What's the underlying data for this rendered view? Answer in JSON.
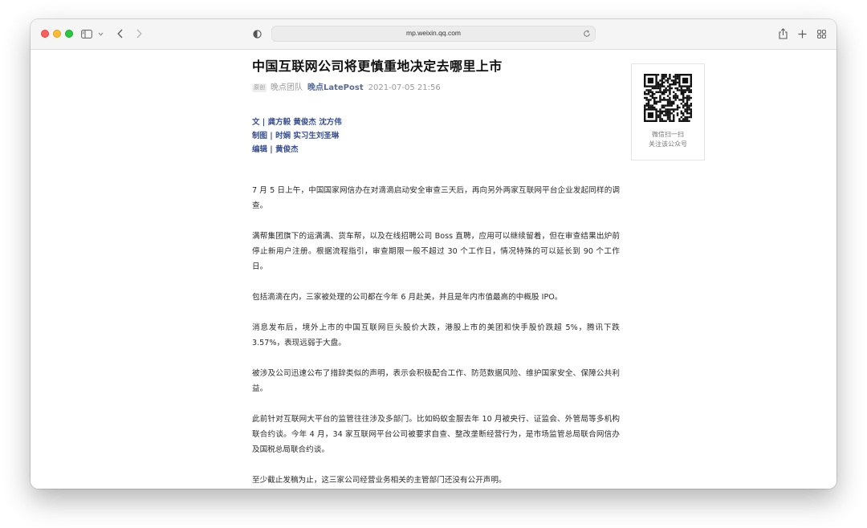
{
  "browser": {
    "url": "mp.weixin.qq.com",
    "icons": {
      "sidebar": "sidebar-icon",
      "chevron": "chevron-down-icon",
      "back": "back-arrow-icon",
      "forward": "forward-arrow-icon",
      "privacy": "privacy-shield-icon",
      "reload": "reload-icon",
      "share": "share-icon",
      "new_tab": "plus-icon",
      "tab_overview": "tab-overview-icon"
    }
  },
  "article": {
    "title": "中国互联网公司将更慎重地决定去哪里上市",
    "original_tag": "原创",
    "author": "晚点团队",
    "account": "晚点LatePost",
    "date": "2021-07-05 21:56",
    "credits": [
      "文 | 龚方毅 黄俊杰 沈方伟",
      "制图 | 时娴 实习生刘圣琳",
      "编辑 | 黄俊杰"
    ],
    "paragraphs": [
      "7 月 5 日上午，中国国家网信办在对滴滴启动安全审查三天后，再向另外两家互联网平台企业发起同样的调查。",
      "满帮集团旗下的运满满、货车帮，以及在线招聘公司 Boss 直聘，应用可以继续留着，但在审查结果出炉前停止新用户注册。根据流程指引，审查期限一般不超过 30 个工作日，情况特殊的可以延长到 90 个工作日。",
      "包括滴滴在内，三家被处理的公司都在今年 6 月赴美，并且是年内市值最高的中概股 IPO。",
      "消息发布后，境外上市的中国互联网巨头股价大跌，港股上市的美团和快手股价跌超 5%，腾讯下跌 3.57%，表现远弱于大盘。",
      "被涉及公司迅速公布了措辞类似的声明，表示会积极配合工作、防范数据风险、维护国家安全、保障公共利益。",
      "此前针对互联网大平台的监管往往涉及多部门。比如蚂蚁金服去年 10 月被央行、证监会、外管局等多机构联合约谈。今年 4 月，34 家互联网平台公司被要求自查、整改垄断经营行为，是市场监管总局联合网信办及国税总局联合约谈。",
      "至少截止发稿为止，这三家公司经营业务相关的主管部门还没有公开声明。"
    ]
  },
  "qr_panel": {
    "line1": "微信扫一扫",
    "line2": "关注该公众号"
  },
  "colors": {
    "accent_link": "#576b95",
    "credit_blue": "#3a4f8c",
    "toolbar_bg": "#f6f5f6"
  }
}
